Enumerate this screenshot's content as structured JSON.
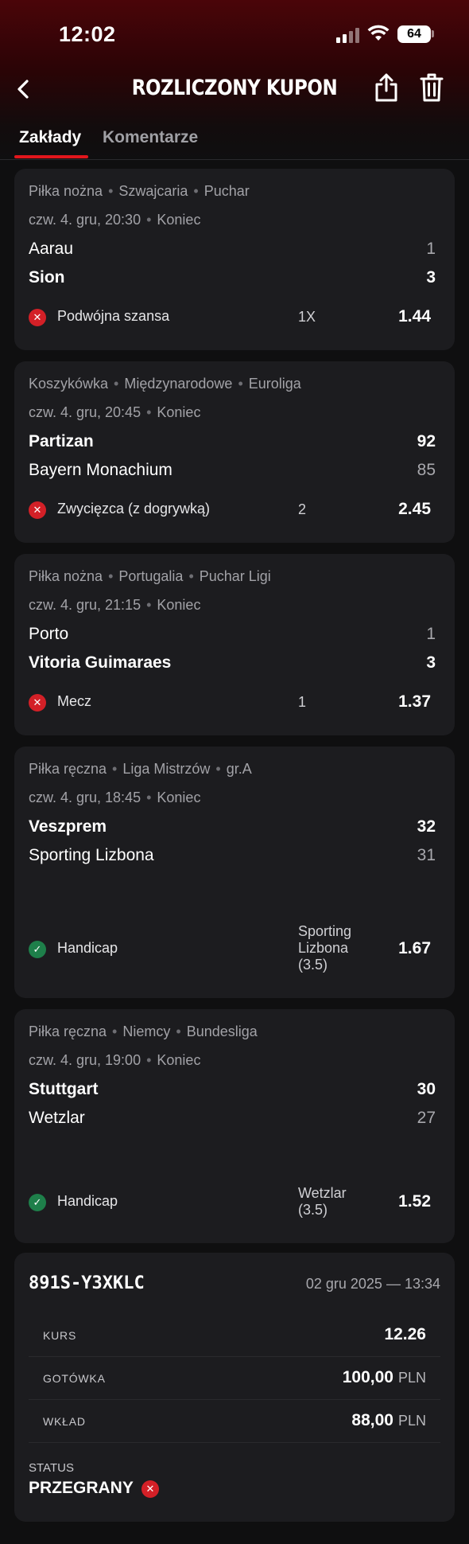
{
  "status_bar": {
    "time": "12:02",
    "battery": "64"
  },
  "nav": {
    "title": "ROZLICZONY KUPON"
  },
  "tabs": [
    {
      "label": "Zakłady",
      "active": true
    },
    {
      "label": "Komentarze",
      "active": false
    }
  ],
  "bets": [
    {
      "sport": "Piłka nożna",
      "region": "Szwajcaria",
      "league": "Puchar",
      "datetime": "czw. 4. gru, 20:30",
      "state": "Koniec",
      "home": {
        "name": "Aarau",
        "score": "1",
        "win": false
      },
      "away": {
        "name": "Sion",
        "score": "3",
        "win": true
      },
      "market": "Podwójna szansa",
      "pick": "1X",
      "odd": "1.44",
      "result": "lost"
    },
    {
      "sport": "Koszykówka",
      "region": "Międzynarodowe",
      "league": "Euroliga",
      "datetime": "czw. 4. gru, 20:45",
      "state": "Koniec",
      "home": {
        "name": "Partizan",
        "score": "92",
        "win": true
      },
      "away": {
        "name": "Bayern Monachium",
        "score": "85",
        "win": false
      },
      "market": "Zwycięzca (z dogrywką)",
      "pick": "2",
      "odd": "2.45",
      "result": "lost"
    },
    {
      "sport": "Piłka nożna",
      "region": "Portugalia",
      "league": "Puchar Ligi",
      "datetime": "czw. 4. gru, 21:15",
      "state": "Koniec",
      "home": {
        "name": "Porto",
        "score": "1",
        "win": false
      },
      "away": {
        "name": "Vitoria Guimaraes",
        "score": "3",
        "win": true
      },
      "market": "Mecz",
      "pick": "1",
      "odd": "1.37",
      "result": "lost"
    },
    {
      "sport": "Piłka ręczna",
      "region": "Liga Mistrzów",
      "league": "gr.A",
      "datetime": "czw. 4. gru, 18:45",
      "state": "Koniec",
      "home": {
        "name": "Veszprem",
        "score": "32",
        "win": true
      },
      "away": {
        "name": "Sporting Lizbona",
        "score": "31",
        "win": false
      },
      "market": "Handicap",
      "pick_lines": [
        "Sporting",
        "Lizbona",
        "(3.5)"
      ],
      "odd": "1.67",
      "result": "won"
    },
    {
      "sport": "Piłka ręczna",
      "region": "Niemcy",
      "league": "Bundesliga",
      "datetime": "czw. 4. gru, 19:00",
      "state": "Koniec",
      "home": {
        "name": "Stuttgart",
        "score": "30",
        "win": true
      },
      "away": {
        "name": "Wetzlar",
        "score": "27",
        "win": false
      },
      "market": "Handicap",
      "pick_lines": [
        "Wetzlar",
        "(3.5)"
      ],
      "odd": "1.52",
      "result": "won"
    }
  ],
  "summary": {
    "coupon_id": "891S-Y3XKLC",
    "date": "02 gru 2025 — 13:34",
    "rows": [
      {
        "label": "KURS",
        "value": "12.26",
        "unit": ""
      },
      {
        "label": "GOTÓWKA",
        "value": "100,00",
        "unit": "PLN"
      },
      {
        "label": "WKŁAD",
        "value": "88,00",
        "unit": "PLN"
      }
    ],
    "status_label": "STATUS",
    "status_value": "PRZEGRANY"
  },
  "colors": {
    "accent": "#e1161c",
    "lost": "#d32027",
    "won": "#1e7f4a",
    "card": "#1c1c1f"
  },
  "icons": [
    "back-chevron-icon",
    "share-icon",
    "trash-icon",
    "lost-x-icon",
    "won-check-icon"
  ]
}
